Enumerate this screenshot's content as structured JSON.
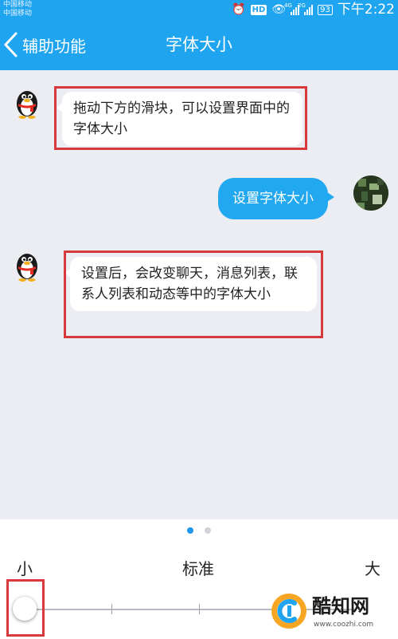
{
  "status_bar": {
    "carrier_1": "中国移动",
    "carrier_2": "中国移动",
    "network_1": "4G",
    "network_2": "2G",
    "battery": "93",
    "time": "下午2:22",
    "icons": [
      "alarm-icon",
      "hd-icon",
      "eye-icon",
      "signal-icon",
      "battery-icon"
    ]
  },
  "header": {
    "back_label": "辅助功能",
    "title": "字体大小",
    "background": "#1fa4f0"
  },
  "chat": {
    "messages": [
      {
        "from": "qq-penguin",
        "text": "拖动下方的滑块，可以设置界面中的字体大小"
      },
      {
        "from": "user",
        "text": "设置字体大小"
      },
      {
        "from": "qq-penguin",
        "text": "设置后，会改变聊天，消息列表，联系人列表和动态等中的字体大小"
      }
    ],
    "highlight_color": "#d83a3c"
  },
  "pager": {
    "pages": 2,
    "active": 1
  },
  "slider": {
    "min_label": "小",
    "mid_label": "标准",
    "max_label": "大",
    "steps": 5,
    "value_step": 1
  },
  "watermark": {
    "name": "酷知网",
    "url": "www.coozhi.com"
  }
}
